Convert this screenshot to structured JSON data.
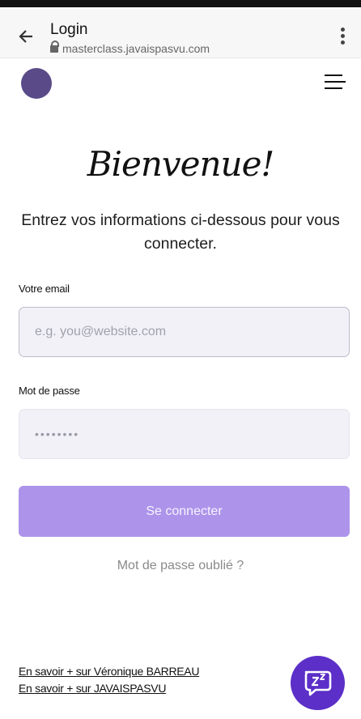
{
  "browser": {
    "title": "Login",
    "url": "masterclass.javaispasvu.com"
  },
  "page": {
    "welcome": "Bienvenue!",
    "subtitle": "Entrez vos informations ci-dessous pour vous connecter."
  },
  "form": {
    "email_label": "Votre email",
    "email_placeholder": "e.g. you@website.com",
    "password_label": "Mot de passe",
    "password_value": "••••••••",
    "submit_label": "Se connecter",
    "forgot_label": "Mot de passe oublié ?"
  },
  "footer": {
    "link1": "En savoir + sur Véronique BARREAU",
    "link2": "En savoir + sur JAVAISPASVU"
  },
  "colors": {
    "logo": "#5a4b88",
    "button": "#ad94ea",
    "chat": "#5c2fc8"
  },
  "icons": {
    "back": "arrow-left-icon",
    "lock": "lock-icon",
    "more": "kebab-icon",
    "menu": "hamburger-icon",
    "chat": "chat-sleep-icon"
  }
}
